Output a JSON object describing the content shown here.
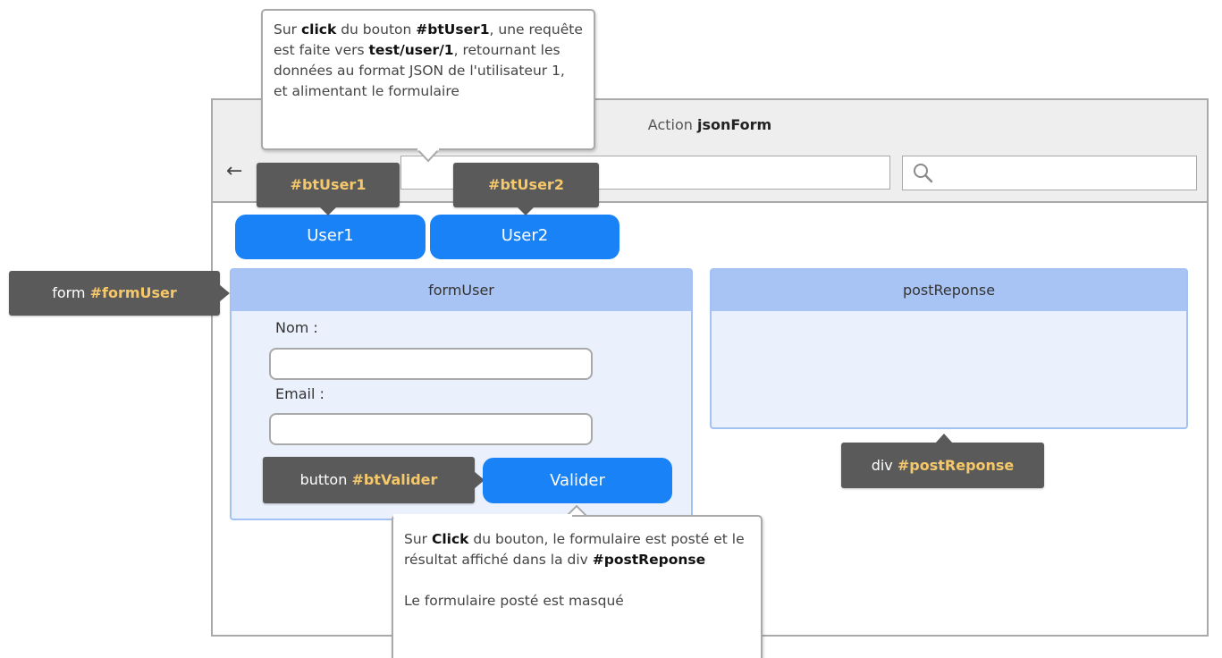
{
  "window": {
    "title_prefix": "Action",
    "title_bold": "jsonForm"
  },
  "buttons": {
    "user1_label": "User1",
    "user2_label": "User2",
    "valider_label": "Valider"
  },
  "callouts": {
    "btuser1": "#btUser1",
    "btuser2": "#btUser2",
    "form_prefix": "form",
    "form_id": "#formUser",
    "button_prefix": "button",
    "button_id": "#btValider",
    "div_prefix": "div",
    "div_id": "#postReponse"
  },
  "form_panel": {
    "title": "formUser",
    "nom_label": "Nom :",
    "email_label": "Email :",
    "nom_value": "",
    "email_value": ""
  },
  "response_panel": {
    "title": "postReponse"
  },
  "note_top": {
    "t1": "Sur ",
    "b1": "click",
    "t2": " du bouton ",
    "b2": "#btUser1",
    "t3": ", une requête est faite vers ",
    "b3": "test/user/1",
    "t4": ", retournant les données au format JSON de l'utilisateur 1, et alimentant le formulaire"
  },
  "note_bottom": {
    "t1": "Sur ",
    "b1": "Click",
    "t2": " du bouton, le formulaire est posté et le résultat affiché dans la div ",
    "b2": "#postReponse",
    "p2": "Le formulaire posté est masqué"
  },
  "colors": {
    "primary_button": "#1a82f7",
    "callout_bg": "#5a5a5a",
    "callout_highlight": "#f5c86b",
    "panel_header": "#a8c4f5",
    "panel_body": "#eaf1fd"
  }
}
